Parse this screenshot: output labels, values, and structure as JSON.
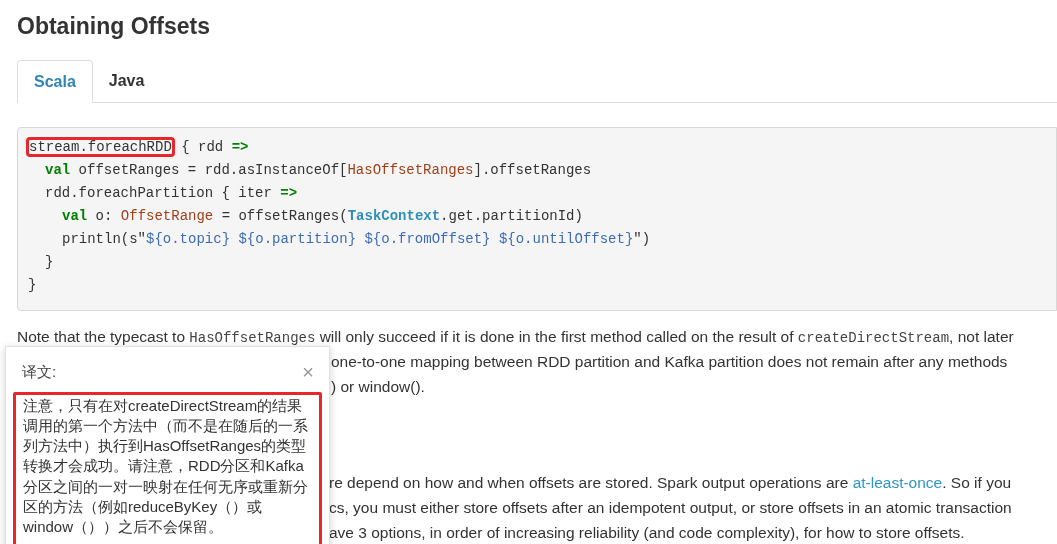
{
  "heading": "Obtaining Offsets",
  "tabs": [
    {
      "label": "Scala",
      "selected": true
    },
    {
      "label": "Java",
      "selected": false
    }
  ],
  "code": {
    "lines": [
      {
        "tokens": [
          {
            "kind": "plain",
            "text": "stream.foreachRDD",
            "boxed": true
          },
          {
            "kind": "plain",
            "text": " { rdd "
          },
          {
            "kind": "keyword",
            "text": "=>"
          }
        ],
        "children": [
          {
            "tokens": [
              {
                "kind": "keyword",
                "text": "val"
              },
              {
                "kind": "plain",
                "text": " offsetRanges = rdd.asInstanceOf["
              },
              {
                "kind": "type",
                "text": "HasOffsetRanges"
              },
              {
                "kind": "plain",
                "text": "].offsetRanges"
              }
            ]
          },
          {
            "tokens": [
              {
                "kind": "plain",
                "text": "rdd.foreachPartition { iter "
              },
              {
                "kind": "keyword",
                "text": "=>"
              }
            ],
            "children": [
              {
                "tokens": [
                  {
                    "kind": "keyword",
                    "text": "val"
                  },
                  {
                    "kind": "plain",
                    "text": " o: "
                  },
                  {
                    "kind": "type",
                    "text": "OffsetRange"
                  },
                  {
                    "kind": "plain",
                    "text": " = offsetRanges("
                  },
                  {
                    "kind": "class",
                    "text": "TaskContext"
                  },
                  {
                    "kind": "plain",
                    "text": ".get.partitionId)"
                  }
                ]
              },
              {
                "tokens": [
                  {
                    "kind": "plain",
                    "text": "println(s\""
                  },
                  {
                    "kind": "string",
                    "text": "${o.topic}"
                  },
                  {
                    "kind": "string",
                    "text": " ${o.partition}"
                  },
                  {
                    "kind": "string",
                    "text": " ${o.fromOffset}"
                  },
                  {
                    "kind": "string",
                    "text": " ${o.untilOffset}"
                  },
                  {
                    "kind": "plain",
                    "text": "\")"
                  }
                ]
              }
            ]
          },
          {
            "tokens": [
              {
                "kind": "plain",
                "text": "}"
              }
            ]
          }
        ]
      },
      {
        "tokens": [
          {
            "kind": "plain",
            "text": "}"
          }
        ]
      }
    ]
  },
  "paragraph_1": {
    "lines": [
      [
        {
          "kind": "text",
          "text": "Note that the typecast to "
        },
        {
          "kind": "code",
          "text": "HasOffsetRanges"
        },
        {
          "kind": "text",
          "text": " will only succeed if it is done in the first method called on the result of "
        },
        {
          "kind": "code",
          "text": "createDirectStream"
        },
        {
          "kind": "text",
          "text": ", not later"
        }
      ],
      [
        {
          "kind": "text",
          "text": "one-to-one mapping between RDD partition and Kafka partition does not remain after any methods"
        }
      ],
      [
        {
          "kind": "text",
          "text": ") or window()."
        }
      ]
    ]
  },
  "paragraph_2": {
    "lines": [
      [
        {
          "kind": "text",
          "text": "re depend on how and when offsets are stored. Spark output operations are "
        },
        {
          "kind": "link",
          "text": "at-least-once"
        },
        {
          "kind": "text",
          "text": ". So if you"
        }
      ],
      [
        {
          "kind": "text",
          "text": "cs, you must either store offsets after an idempotent output, or store offsets in an atomic transaction"
        }
      ],
      [
        {
          "kind": "text",
          "text": "ave 3 options, in order of increasing reliability (and code complexity), for how to store offsets."
        }
      ]
    ]
  },
  "translation_popup": {
    "title": "译文:",
    "close": "×",
    "text": "注意，只有在对createDirectStream的结果调用的第一个方法中（而不是在随后的一系列方法中）执行到HasOffsetRanges的类型转换才会成功。请注意，RDD分区和Kafka分区之间的一对一映射在任何无序或重新分区的方法（例如reduceByKey（）或window（））之后不会保留。"
  }
}
